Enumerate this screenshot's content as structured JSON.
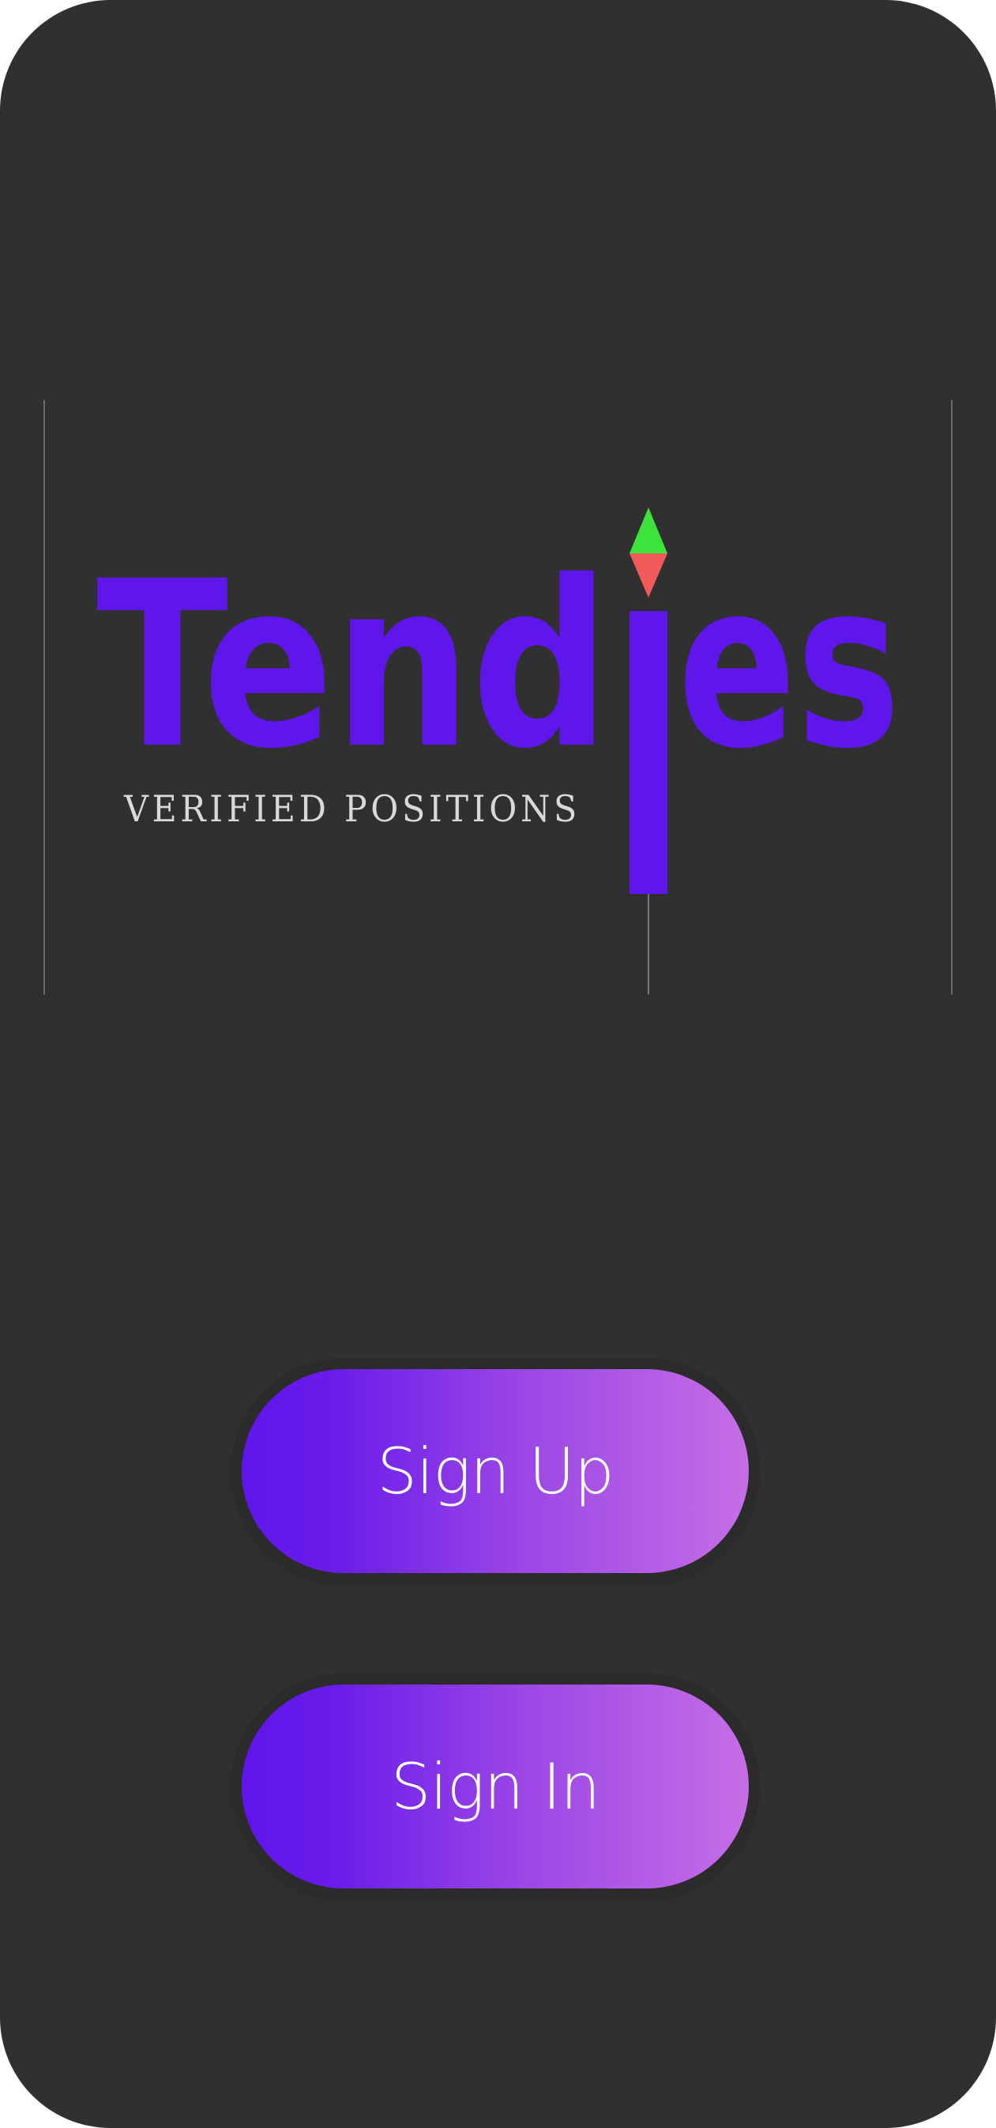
{
  "logo": {
    "word_start": "Tend",
    "word_end": "es",
    "tagline": "VERIFIED POSITIONS",
    "colors": {
      "brand": "#5f16eb",
      "up_arrow": "#3de23a",
      "down_arrow": "#f35b5b",
      "tagline": "#d9d9d9",
      "guide_lines": "#6a6a6a"
    }
  },
  "actions": {
    "sign_up_label": "Sign Up",
    "sign_in_label": "Sign In"
  },
  "theme": {
    "background": "#303030",
    "button_gradient": [
      "#5f16eb",
      "#c66ee6"
    ]
  }
}
